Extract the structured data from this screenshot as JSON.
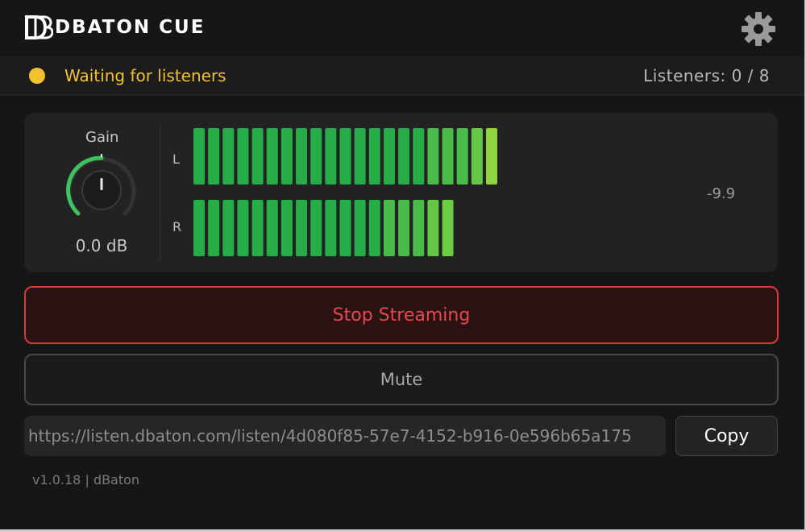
{
  "app": {
    "logo_text": "DBATON CUE"
  },
  "status": {
    "text": "Waiting for listeners",
    "listeners": "Listeners: 0 / 8",
    "dot_color": "#f2c22e"
  },
  "meter": {
    "gain_label": "Gain",
    "gain_value": "0.0 dB",
    "left_label": "L",
    "right_label": "R",
    "peak_readout": "-9.9",
    "left_segments_lit": 21,
    "right_segments_lit": 18
  },
  "buttons": {
    "stop": "Stop Streaming",
    "mute": "Mute",
    "copy": "Copy"
  },
  "url": {
    "value": "https://listen.dbaton.com/listen/4d080f85-57e7-4152-b916-0e596b65a175"
  },
  "footer": {
    "version": "v1.0.18 | dBaton"
  },
  "icons": {
    "settings": "gear-icon",
    "status": "status-dot-icon",
    "logo": "db-logo-icon"
  },
  "colors": {
    "accent_green": "#2db34a",
    "warning_yellow": "#f2c22e",
    "stop_red": "#d63a3a"
  }
}
